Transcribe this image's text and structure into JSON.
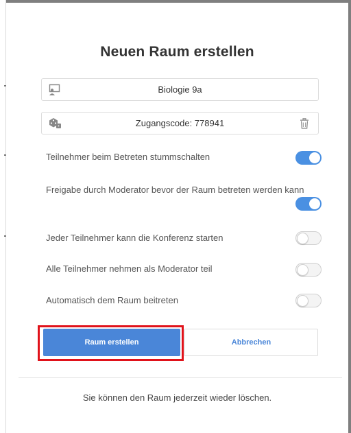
{
  "dialog": {
    "title": "Neuen Raum erstellen",
    "room_name": {
      "value": "Biologie 9a",
      "icon": "presentation-icon"
    },
    "access_code": {
      "value": "Zugangscode: 778941",
      "icon": "dice-icon",
      "action_icon": "trash-icon"
    },
    "options": [
      {
        "label": "Teilnehmer beim Betreten stummschalten",
        "enabled": true
      },
      {
        "label": "Freigabe durch Moderator bevor der Raum betreten werden kann",
        "enabled": true
      },
      {
        "label": "Jeder Teilnehmer kann die Konferenz starten",
        "enabled": false
      },
      {
        "label": "Alle Teilnehmer nehmen als Moderator teil",
        "enabled": false
      },
      {
        "label": "Automatisch dem Raum beitreten",
        "enabled": false
      }
    ],
    "create_label": "Raum erstellen",
    "cancel_label": "Abbrechen",
    "footer_note": "Sie können den Raum jederzeit wieder löschen.",
    "colors": {
      "accent": "#4a86d8",
      "toggle_on": "#4a90e2",
      "highlight": "#e0121a"
    }
  }
}
